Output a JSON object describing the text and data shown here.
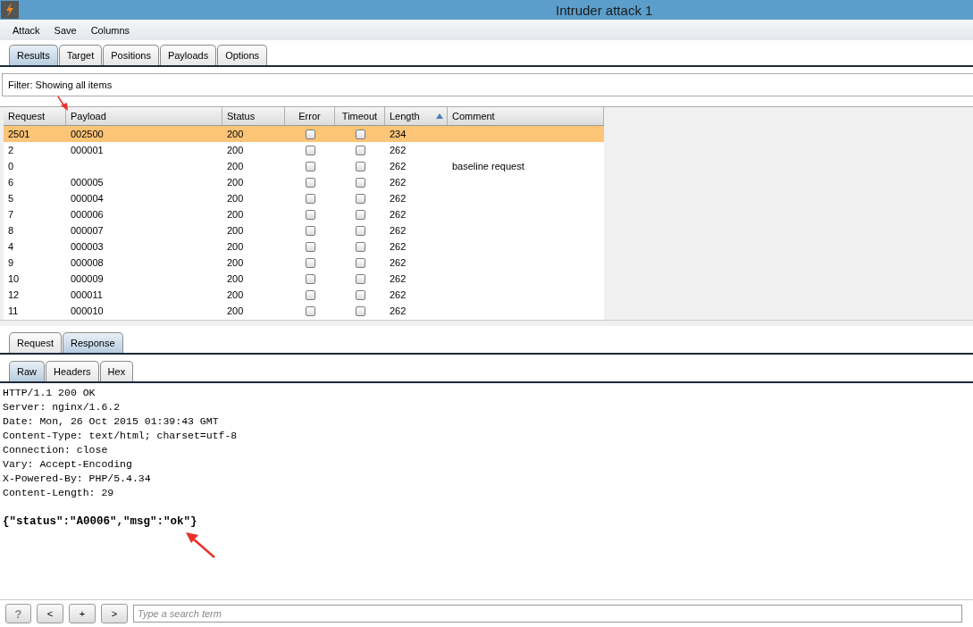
{
  "window": {
    "title": "Intruder attack 1"
  },
  "menu": [
    "Attack",
    "Save",
    "Columns"
  ],
  "tabs": [
    {
      "label": "Results",
      "selected": true
    },
    {
      "label": "Target",
      "selected": false
    },
    {
      "label": "Positions",
      "selected": false
    },
    {
      "label": "Payloads",
      "selected": false
    },
    {
      "label": "Options",
      "selected": false
    }
  ],
  "filter": "Filter:  Showing all items",
  "table": {
    "columns": [
      {
        "label": "Request",
        "sorted": false
      },
      {
        "label": "Payload",
        "sorted": false
      },
      {
        "label": "Status",
        "sorted": false
      },
      {
        "label": "Error",
        "sorted": false
      },
      {
        "label": "Timeout",
        "sorted": false
      },
      {
        "label": "Length",
        "sorted": true
      },
      {
        "label": "Comment",
        "sorted": false
      }
    ],
    "rows": [
      {
        "request": "2501",
        "payload": "002500",
        "status": "200",
        "error": false,
        "timeout": false,
        "length": "234",
        "comment": "",
        "selected": true
      },
      {
        "request": "2",
        "payload": "000001",
        "status": "200",
        "error": false,
        "timeout": false,
        "length": "262",
        "comment": "",
        "selected": false
      },
      {
        "request": "0",
        "payload": "",
        "status": "200",
        "error": false,
        "timeout": false,
        "length": "262",
        "comment": "baseline request",
        "selected": false
      },
      {
        "request": "6",
        "payload": "000005",
        "status": "200",
        "error": false,
        "timeout": false,
        "length": "262",
        "comment": "",
        "selected": false
      },
      {
        "request": "5",
        "payload": "000004",
        "status": "200",
        "error": false,
        "timeout": false,
        "length": "262",
        "comment": "",
        "selected": false
      },
      {
        "request": "7",
        "payload": "000006",
        "status": "200",
        "error": false,
        "timeout": false,
        "length": "262",
        "comment": "",
        "selected": false
      },
      {
        "request": "8",
        "payload": "000007",
        "status": "200",
        "error": false,
        "timeout": false,
        "length": "262",
        "comment": "",
        "selected": false
      },
      {
        "request": "4",
        "payload": "000003",
        "status": "200",
        "error": false,
        "timeout": false,
        "length": "262",
        "comment": "",
        "selected": false
      },
      {
        "request": "9",
        "payload": "000008",
        "status": "200",
        "error": false,
        "timeout": false,
        "length": "262",
        "comment": "",
        "selected": false
      },
      {
        "request": "10",
        "payload": "000009",
        "status": "200",
        "error": false,
        "timeout": false,
        "length": "262",
        "comment": "",
        "selected": false
      },
      {
        "request": "12",
        "payload": "000011",
        "status": "200",
        "error": false,
        "timeout": false,
        "length": "262",
        "comment": "",
        "selected": false
      },
      {
        "request": "11",
        "payload": "000010",
        "status": "200",
        "error": false,
        "timeout": false,
        "length": "262",
        "comment": "",
        "selected": false
      }
    ]
  },
  "message_tabs": [
    {
      "label": "Request",
      "selected": false
    },
    {
      "label": "Response",
      "selected": true
    }
  ],
  "view_tabs": [
    {
      "label": "Raw",
      "selected": true
    },
    {
      "label": "Headers",
      "selected": false
    },
    {
      "label": "Hex",
      "selected": false
    }
  ],
  "response": {
    "headers": [
      "HTTP/1.1 200 OK",
      "Server: nginx/1.6.2",
      "Date: Mon, 26 Oct 2015 01:39:43 GMT",
      "Content-Type: text/html; charset=utf-8",
      "Connection: close",
      "Vary: Accept-Encoding",
      "X-Powered-By: PHP/5.4.34",
      "Content-Length: 29"
    ],
    "body": "{\"status\":\"A0006\",\"msg\":\"ok\"}"
  },
  "bottom_bar": {
    "buttons": [
      "?",
      "<",
      "+",
      ">"
    ],
    "search": {
      "placeholder": "Type a search term"
    }
  }
}
